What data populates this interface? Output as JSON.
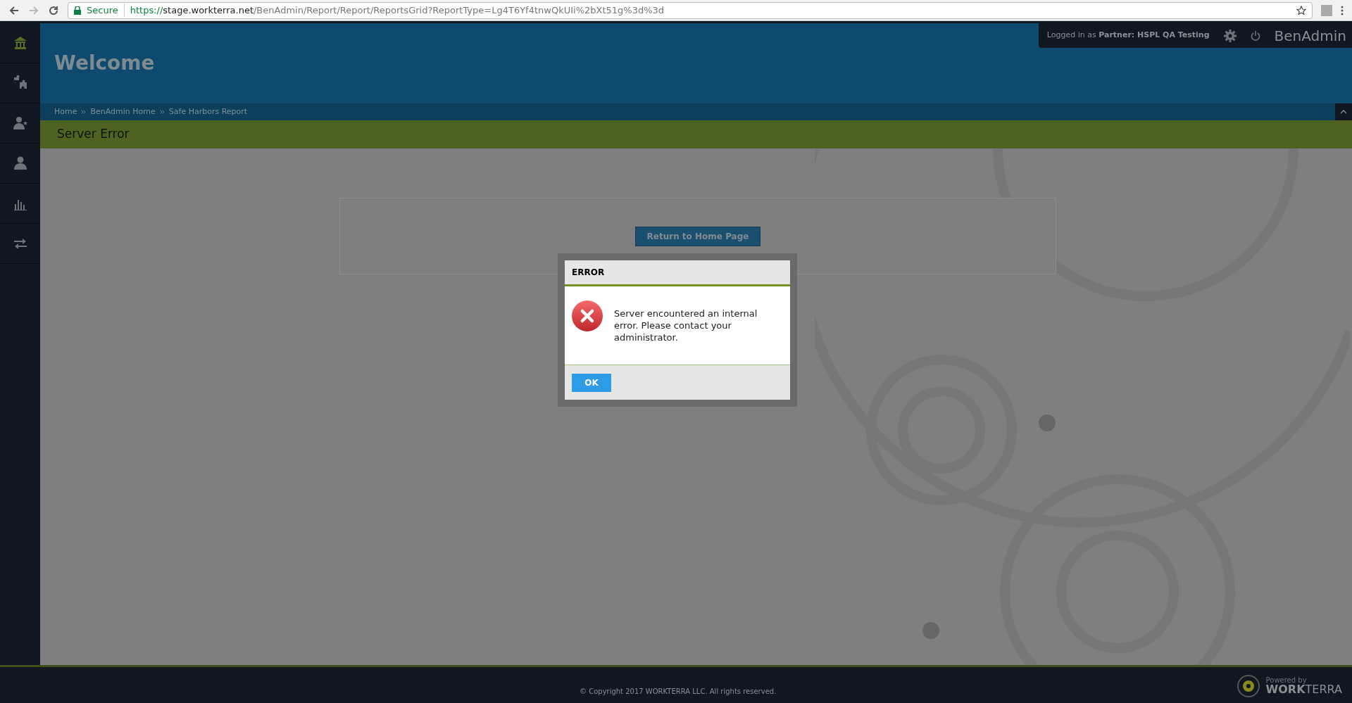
{
  "browser": {
    "secure_label": "Secure",
    "url_scheme": "https://",
    "url_host": "stage.workterra.net",
    "url_path": "/BenAdmin/Report/Report/ReportsGrid?ReportType=Lg4T6Yf4tnwQkUIi%2bXt51g%3d%3d"
  },
  "sidebar": {
    "items": [
      {
        "kind": "home",
        "selected": true
      },
      {
        "kind": "puzzle",
        "selected": false
      },
      {
        "kind": "user-star",
        "selected": false
      },
      {
        "kind": "user",
        "selected": false
      },
      {
        "kind": "chart",
        "selected": false
      },
      {
        "kind": "transfer",
        "selected": false
      }
    ]
  },
  "header": {
    "welcome": "Welcome",
    "login_info": "Logged in as **Partner:  HSPL QA Testing**",
    "app_name": "BenAdmin"
  },
  "breadcrumbs": [
    "Home",
    "BenAdmin Home",
    "Safe Harbors Report"
  ],
  "page_title": "Server Error",
  "return_button": "Return to Home Page",
  "dialog": {
    "title": "ERROR",
    "message": "Server encountered an internal error. Please contact your administrator.",
    "ok_button": "OK"
  },
  "footer": {
    "copyright": "© Copyright 2017 WORKTERRA LLC. All rights reserved.",
    "powered_by": "Powered by",
    "brand": "**WORK**TERRA"
  }
}
